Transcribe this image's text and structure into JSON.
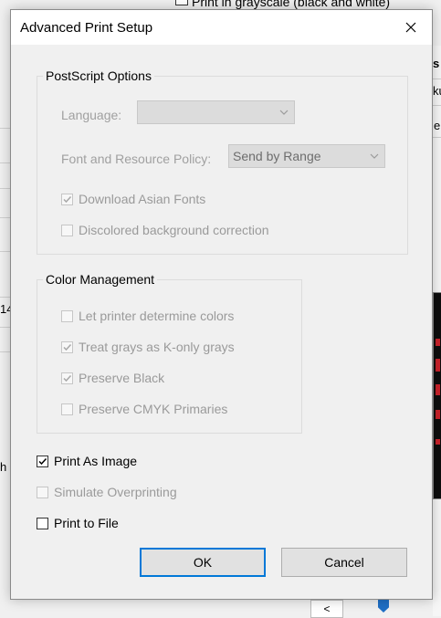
{
  "background": {
    "top_check_text": "Print in grayscale (black and white)",
    "right_s": "s",
    "right_ku": "ku",
    "right_e": "e",
    "left_14": "14",
    "left_h": "h",
    "scroll_left": "<"
  },
  "dialog": {
    "title": "Advanced Print Setup",
    "close_glyph": "close",
    "postscript": {
      "legend": "PostScript Options",
      "language_label": "Language:",
      "language_value": "",
      "font_policy_label": "Font and Resource Policy:",
      "font_policy_value": "Send by Range",
      "download_asian_fonts": {
        "label": "Download Asian Fonts",
        "checked": true,
        "enabled": false
      },
      "discolored_bg": {
        "label": "Discolored background correction",
        "checked": false,
        "enabled": false
      }
    },
    "color_mgmt": {
      "legend": "Color Management",
      "items": [
        {
          "label": "Let printer determine colors",
          "checked": false,
          "enabled": false
        },
        {
          "label": "Treat grays as K-only grays",
          "checked": true,
          "enabled": false
        },
        {
          "label": "Preserve Black",
          "checked": true,
          "enabled": false
        },
        {
          "label": "Preserve CMYK Primaries",
          "checked": false,
          "enabled": false
        }
      ]
    },
    "print_as_image": {
      "label": "Print As Image",
      "checked": true,
      "enabled": true
    },
    "simulate_overprinting": {
      "label": "Simulate Overprinting",
      "checked": false,
      "enabled": false
    },
    "print_to_file": {
      "label": "Print to File",
      "checked": false,
      "enabled": true
    },
    "ok_label": "OK",
    "cancel_label": "Cancel"
  },
  "colors": {
    "accent": "#0078d7",
    "disabled_text": "#a0a0a0",
    "dialog_bg": "#f0f0f0"
  }
}
